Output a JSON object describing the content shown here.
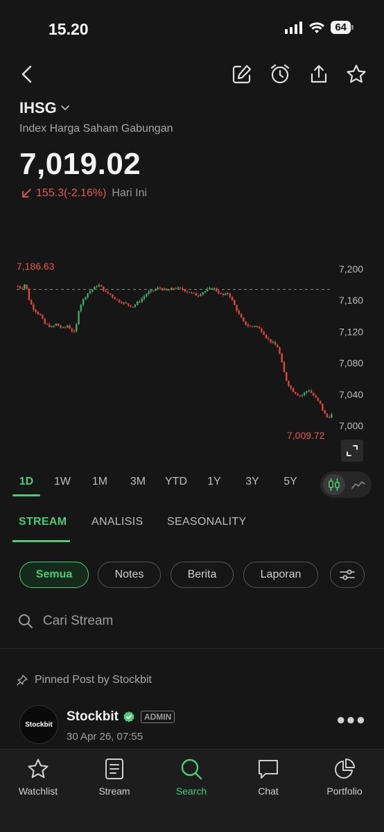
{
  "status_bar": {
    "time": "15.20",
    "battery": "64"
  },
  "stock": {
    "ticker": "IHSG",
    "name": "Index Harga Saham Gabungan",
    "price": "7,019.02",
    "change": "155.3(-2.16%)",
    "change_period": "Hari Ini"
  },
  "chart_data": {
    "type": "candlestick",
    "high_label": "7,186.63",
    "low_label": "7,009.72",
    "previous_close_line": 7174,
    "y_ticks": [
      "7,200",
      "7,160",
      "7,120",
      "7,080",
      "7,040",
      "7,000"
    ],
    "ylim": [
      7000,
      7200
    ],
    "series": [
      {
        "name": "",
        "path": [
          7178,
          7175,
          7182,
          7160,
          7150,
          7145,
          7140,
          7130,
          7128,
          7125,
          7130,
          7126,
          7124,
          7128,
          7122,
          7118,
          7150,
          7160,
          7168,
          7172,
          7176,
          7180,
          7176,
          7170,
          7168,
          7164,
          7160,
          7158,
          7156,
          7154,
          7152,
          7156,
          7160,
          7165,
          7170,
          7172,
          7174,
          7176,
          7174,
          7172,
          7174,
          7176,
          7175,
          7174,
          7172,
          7170,
          7168,
          7166,
          7170,
          7172,
          7174,
          7176,
          7172,
          7168,
          7166,
          7170,
          7160,
          7150,
          7140,
          7132,
          7128,
          7126,
          7128,
          7124,
          7120,
          7112,
          7108,
          7104,
          7100,
          7080,
          7060,
          7050,
          7044,
          7040,
          7038,
          7042,
          7046,
          7040,
          7034,
          7028,
          7016,
          7010,
          7014
        ]
      }
    ]
  },
  "periods": [
    "1D",
    "1W",
    "1M",
    "3M",
    "YTD",
    "1Y",
    "3Y",
    "5Y"
  ],
  "active_period": "1D",
  "content_tabs": [
    "STREAM",
    "ANALISIS",
    "SEASONALITY"
  ],
  "chips": [
    "Semua",
    "Notes",
    "Berita",
    "Laporan"
  ],
  "search": {
    "placeholder": "Cari Stream"
  },
  "pinned": {
    "label": "Pinned Post by Stockbit"
  },
  "post": {
    "author": "Stockbit",
    "badge": "ADMIN",
    "date": "30 Apr 26, 07:55",
    "avatar_text": "Stockbit"
  },
  "bottom_nav": [
    "Watchlist",
    "Stream",
    "Search",
    "Chat",
    "Portfolio"
  ],
  "colors": {
    "accent": "#4ecb76",
    "down": "#e25a4f",
    "background": "#161616"
  }
}
